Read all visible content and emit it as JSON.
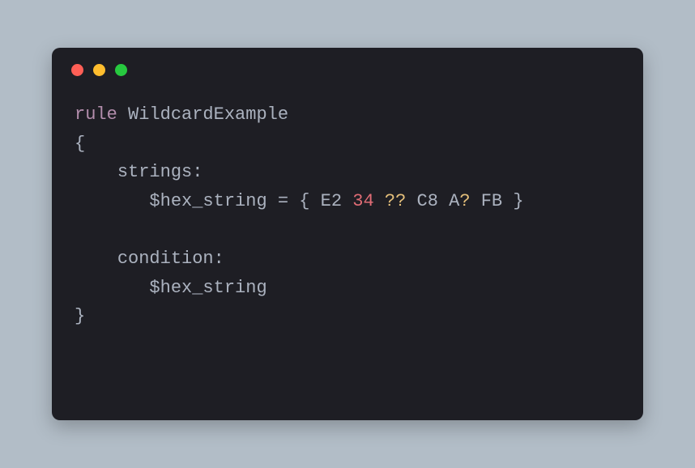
{
  "window": {
    "controls": [
      "close",
      "minimize",
      "zoom"
    ]
  },
  "code": {
    "rule_keyword": "rule",
    "rule_name": "WildcardExample",
    "open_brace": "{",
    "strings_label": "strings:",
    "var_name": "$hex_string",
    "equals": "=",
    "hex_open": "{",
    "hex_tokens": {
      "t0": "E2",
      "t1": "34",
      "t2": "??",
      "t3": "C8",
      "t4a": "A",
      "t4b": "?",
      "t5": "FB"
    },
    "hex_close": "}",
    "condition_label": "condition:",
    "cond_expr": "$hex_string",
    "close_brace": "}"
  }
}
